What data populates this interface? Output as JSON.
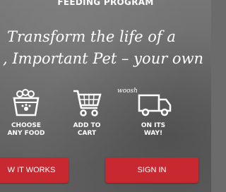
{
  "header": {
    "title": "FEEDING PROGRAM"
  },
  "tagline": {
    "line1": "Transform the life of a",
    "line2": ", Important Pet – your own"
  },
  "steps": [
    {
      "icon": "food-bowl-icon",
      "label_line1": "CHOOSE",
      "label_line2": "ANY FOOD"
    },
    {
      "icon": "shopping-cart-icon",
      "label_line1": "ADD TO",
      "label_line2": "CART"
    },
    {
      "icon": "delivery-truck-icon",
      "label_line1": "ON ITS",
      "label_line2": "WAY!",
      "doodle": "woosh"
    }
  ],
  "buttons": {
    "how_it_works": "W IT WORKS",
    "sign_in": "SIGN IN"
  },
  "colors": {
    "background": "#6b6b6b",
    "button": "#c8282f",
    "text": "#ffffff"
  }
}
